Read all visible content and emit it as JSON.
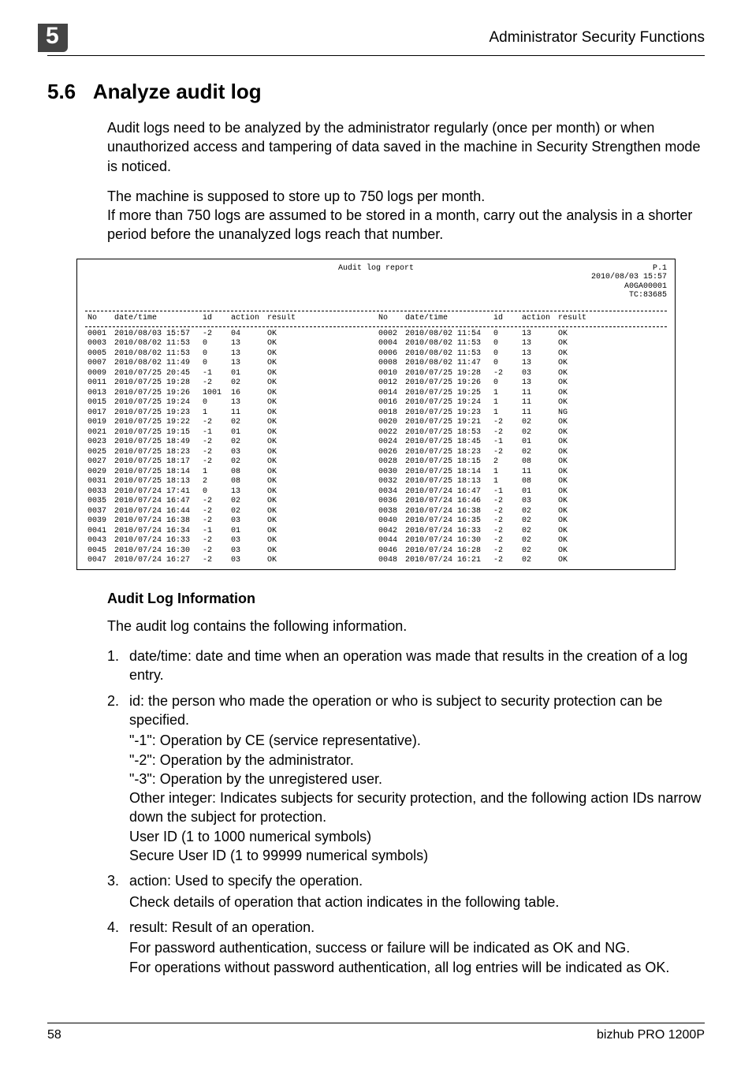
{
  "header": {
    "chapter_number": "5",
    "title": "Administrator Security Functions"
  },
  "section": {
    "number": "5.6",
    "title": "Analyze audit log"
  },
  "paragraphs": {
    "p1": "Audit logs need to be analyzed by the administrator regularly (once per month) or when unauthorized access and tampering of data saved in the machine in Security Strengthen mode is noticed.",
    "p2a": "The machine is supposed to store up to 750 logs per month.",
    "p2b": "If more than 750 logs are assumed to be stored in a month, carry out the analysis in a shorter period before the unanalyzed logs reach that number."
  },
  "log": {
    "title": "Audit log report",
    "meta_page": "P.1",
    "meta_date": "2010/08/03 15:57",
    "meta_serial": "A0GA00001",
    "meta_tc": "TC:83685",
    "columns": {
      "no": "No",
      "datetime": "date/time",
      "id": "id",
      "action": "action",
      "result": "result"
    },
    "rows_left": [
      {
        "no": "0001",
        "dt": "2010/08/03 15:57",
        "id": "-2",
        "act": "04",
        "res": "OK"
      },
      {
        "no": "0003",
        "dt": "2010/08/02 11:53",
        "id": "0",
        "act": "13",
        "res": "OK"
      },
      {
        "no": "0005",
        "dt": "2010/08/02 11:53",
        "id": "0",
        "act": "13",
        "res": "OK"
      },
      {
        "no": "0007",
        "dt": "2010/08/02 11:49",
        "id": "0",
        "act": "13",
        "res": "OK"
      },
      {
        "no": "0009",
        "dt": "2010/07/25 20:45",
        "id": "-1",
        "act": "01",
        "res": "OK"
      },
      {
        "no": "0011",
        "dt": "2010/07/25 19:28",
        "id": "-2",
        "act": "02",
        "res": "OK"
      },
      {
        "no": "0013",
        "dt": "2010/07/25 19:26",
        "id": "1001",
        "act": "16",
        "res": "OK"
      },
      {
        "no": "0015",
        "dt": "2010/07/25 19:24",
        "id": "0",
        "act": "13",
        "res": "OK"
      },
      {
        "no": "0017",
        "dt": "2010/07/25 19:23",
        "id": "1",
        "act": "11",
        "res": "OK"
      },
      {
        "no": "0019",
        "dt": "2010/07/25 19:22",
        "id": "-2",
        "act": "02",
        "res": "OK"
      },
      {
        "no": "0021",
        "dt": "2010/07/25 19:15",
        "id": "-1",
        "act": "01",
        "res": "OK"
      },
      {
        "no": "0023",
        "dt": "2010/07/25 18:49",
        "id": "-2",
        "act": "02",
        "res": "OK"
      },
      {
        "no": "0025",
        "dt": "2010/07/25 18:23",
        "id": "-2",
        "act": "03",
        "res": "OK"
      },
      {
        "no": "0027",
        "dt": "2010/07/25 18:17",
        "id": "-2",
        "act": "02",
        "res": "OK"
      },
      {
        "no": "0029",
        "dt": "2010/07/25 18:14",
        "id": "1",
        "act": "08",
        "res": "OK"
      },
      {
        "no": "0031",
        "dt": "2010/07/25 18:13",
        "id": "2",
        "act": "08",
        "res": "OK"
      },
      {
        "no": "0033",
        "dt": "2010/07/24 17:41",
        "id": "0",
        "act": "13",
        "res": "OK"
      },
      {
        "no": "0035",
        "dt": "2010/07/24 16:47",
        "id": "-2",
        "act": "02",
        "res": "OK"
      },
      {
        "no": "0037",
        "dt": "2010/07/24 16:44",
        "id": "-2",
        "act": "02",
        "res": "OK"
      },
      {
        "no": "0039",
        "dt": "2010/07/24 16:38",
        "id": "-2",
        "act": "03",
        "res": "OK"
      },
      {
        "no": "0041",
        "dt": "2010/07/24 16:34",
        "id": "-1",
        "act": "01",
        "res": "OK"
      },
      {
        "no": "0043",
        "dt": "2010/07/24 16:33",
        "id": "-2",
        "act": "03",
        "res": "OK"
      },
      {
        "no": "0045",
        "dt": "2010/07/24 16:30",
        "id": "-2",
        "act": "03",
        "res": "OK"
      },
      {
        "no": "0047",
        "dt": "2010/07/24 16:27",
        "id": "-2",
        "act": "03",
        "res": "OK"
      }
    ],
    "rows_right": [
      {
        "no": "0002",
        "dt": "2010/08/02 11:54",
        "id": "0",
        "act": "13",
        "res": "OK"
      },
      {
        "no": "0004",
        "dt": "2010/08/02 11:53",
        "id": "0",
        "act": "13",
        "res": "OK"
      },
      {
        "no": "0006",
        "dt": "2010/08/02 11:53",
        "id": "0",
        "act": "13",
        "res": "OK"
      },
      {
        "no": "0008",
        "dt": "2010/08/02 11:47",
        "id": "0",
        "act": "13",
        "res": "OK"
      },
      {
        "no": "0010",
        "dt": "2010/07/25 19:28",
        "id": "-2",
        "act": "03",
        "res": "OK"
      },
      {
        "no": "0012",
        "dt": "2010/07/25 19:26",
        "id": "0",
        "act": "13",
        "res": "OK"
      },
      {
        "no": "0014",
        "dt": "2010/07/25 19:25",
        "id": "1",
        "act": "11",
        "res": "OK"
      },
      {
        "no": "0016",
        "dt": "2010/07/25 19:24",
        "id": "1",
        "act": "11",
        "res": "OK"
      },
      {
        "no": "0018",
        "dt": "2010/07/25 19:23",
        "id": "1",
        "act": "11",
        "res": "NG"
      },
      {
        "no": "0020",
        "dt": "2010/07/25 19:21",
        "id": "-2",
        "act": "02",
        "res": "OK"
      },
      {
        "no": "0022",
        "dt": "2010/07/25 18:53",
        "id": "-2",
        "act": "02",
        "res": "OK"
      },
      {
        "no": "0024",
        "dt": "2010/07/25 18:45",
        "id": "-1",
        "act": "01",
        "res": "OK"
      },
      {
        "no": "0026",
        "dt": "2010/07/25 18:23",
        "id": "-2",
        "act": "02",
        "res": "OK"
      },
      {
        "no": "0028",
        "dt": "2010/07/25 18:15",
        "id": "2",
        "act": "08",
        "res": "OK"
      },
      {
        "no": "0030",
        "dt": "2010/07/25 18:14",
        "id": "1",
        "act": "11",
        "res": "OK"
      },
      {
        "no": "0032",
        "dt": "2010/07/25 18:13",
        "id": "1",
        "act": "08",
        "res": "OK"
      },
      {
        "no": "0034",
        "dt": "2010/07/24 16:47",
        "id": "-1",
        "act": "01",
        "res": "OK"
      },
      {
        "no": "0036",
        "dt": "2010/07/24 16:46",
        "id": "-2",
        "act": "03",
        "res": "OK"
      },
      {
        "no": "0038",
        "dt": "2010/07/24 16:38",
        "id": "-2",
        "act": "02",
        "res": "OK"
      },
      {
        "no": "0040",
        "dt": "2010/07/24 16:35",
        "id": "-2",
        "act": "02",
        "res": "OK"
      },
      {
        "no": "0042",
        "dt": "2010/07/24 16:33",
        "id": "-2",
        "act": "02",
        "res": "OK"
      },
      {
        "no": "0044",
        "dt": "2010/07/24 16:30",
        "id": "-2",
        "act": "02",
        "res": "OK"
      },
      {
        "no": "0046",
        "dt": "2010/07/24 16:28",
        "id": "-2",
        "act": "02",
        "res": "OK"
      },
      {
        "no": "0048",
        "dt": "2010/07/24 16:21",
        "id": "-2",
        "act": "02",
        "res": "OK"
      }
    ]
  },
  "sub_heading": "Audit Log Information",
  "sub_intro": "The audit log contains the following information.",
  "list": {
    "item1": "date/time: date and time when an operation was made that results in the creation of a log entry.",
    "item2": "id: the person who made the operation or who is subject to security protection can be specified.",
    "item2_sub": [
      "\"-1\": Operation by CE (service representative).",
      "\"-2\": Operation by the administrator.",
      "\"-3\": Operation by the unregistered user.",
      "Other integer: Indicates subjects for security protection, and the following action IDs narrow down the subject for protection.",
      "User ID (1 to 1000 numerical symbols)",
      "Secure User ID (1 to 99999 numerical symbols)"
    ],
    "item3": "action: Used to specify the operation.",
    "item3_sub": [
      "Check details of operation that action indicates in the following table."
    ],
    "item4": "result: Result of an operation.",
    "item4_sub": [
      "For password authentication, success or failure will be indicated as OK and NG.",
      "For operations without password authentication, all log entries will be indicated as OK."
    ]
  },
  "footer": {
    "page": "58",
    "product": "bizhub PRO 1200P"
  }
}
